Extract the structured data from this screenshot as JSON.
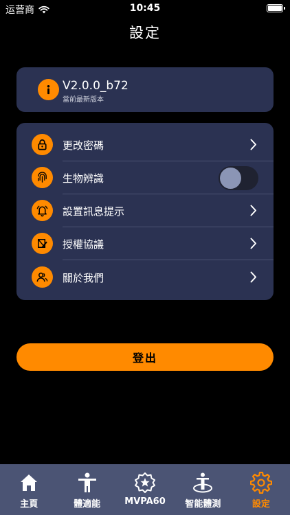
{
  "status_bar": {
    "carrier": "运营商",
    "time": "10:45"
  },
  "page_title": "設定",
  "version": {
    "text": "V2.0.0_b72",
    "subtitle": "當前最新版本",
    "icon": "info-icon"
  },
  "menu": {
    "items": [
      {
        "label": "更改密碼",
        "icon": "lock-icon",
        "control": "chevron"
      },
      {
        "label": "生物辨識",
        "icon": "fingerprint-icon",
        "control": "toggle",
        "toggle_on": false
      },
      {
        "label": "設置訊息提示",
        "icon": "bell-icon",
        "control": "chevron"
      },
      {
        "label": "授權協議",
        "icon": "agreement-icon",
        "control": "chevron"
      },
      {
        "label": "關於我們",
        "icon": "people-icon",
        "control": "chevron"
      }
    ]
  },
  "logout_label": "登出",
  "tabs": [
    {
      "label": "主頁",
      "icon": "home-icon",
      "active": false
    },
    {
      "label": "體適能",
      "icon": "person-icon",
      "active": false
    },
    {
      "label": "MVPA60",
      "icon": "star-badge-icon",
      "active": false
    },
    {
      "label": "智能體測",
      "icon": "body-scan-icon",
      "active": false
    },
    {
      "label": "設定",
      "icon": "gear-icon",
      "active": true
    }
  ],
  "colors": {
    "accent": "#ff8a00",
    "card": "#2b3252",
    "tab_bar": "#4b5474",
    "background": "#000000"
  }
}
